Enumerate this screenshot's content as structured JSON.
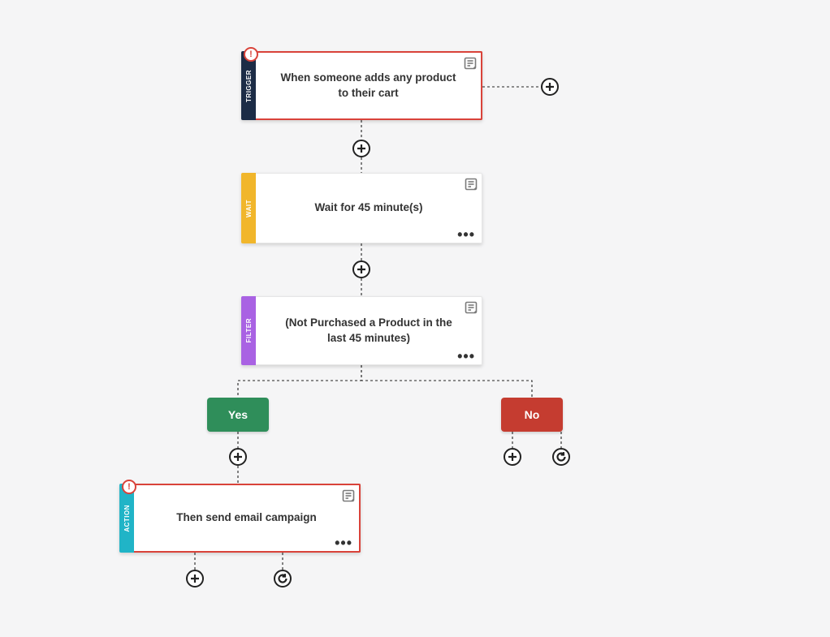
{
  "nodes": {
    "trigger": {
      "tab_label": "TRIGGER",
      "text": "When someone adds any product to their cart",
      "tab_color": "#1c2c46",
      "warning": true,
      "has_note": true,
      "has_more": false
    },
    "wait": {
      "tab_label": "WAIT",
      "text": "Wait for 45 minute(s)",
      "tab_color": "#f1b62b",
      "warning": false,
      "has_note": true,
      "has_more": true
    },
    "filter": {
      "tab_label": "FILTER",
      "text": "(Not Purchased a Product in the last 45 minutes)",
      "tab_color": "#a962e3",
      "warning": false,
      "has_note": true,
      "has_more": true
    },
    "action": {
      "tab_label": "ACTION",
      "text": "Then send email campaign",
      "tab_color": "#20b4c7",
      "warning": true,
      "has_note": true,
      "has_more": true
    }
  },
  "branches": {
    "yes": {
      "label": "Yes",
      "color": "#2f8e5a"
    },
    "no": {
      "label": "No",
      "color": "#c53c30"
    }
  }
}
